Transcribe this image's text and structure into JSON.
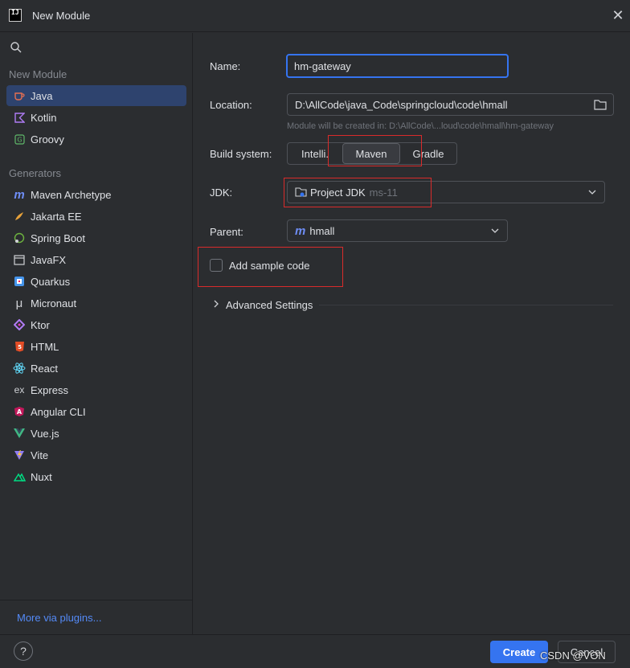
{
  "window": {
    "title": "New Module"
  },
  "sidebar": {
    "new_module_label": "New Module",
    "new_module_items": [
      {
        "label": "Java",
        "icon": "java-cup-icon",
        "color": "#e76f51"
      },
      {
        "label": "Kotlin",
        "icon": "kotlin-icon",
        "color": "#b07cf5"
      },
      {
        "label": "Groovy",
        "icon": "groovy-icon",
        "color": "#5fb86a"
      }
    ],
    "generators_label": "Generators",
    "generator_items": [
      {
        "label": "Maven Archetype",
        "icon": "maven-icon"
      },
      {
        "label": "Jakarta EE",
        "icon": "jakarta-ee-icon"
      },
      {
        "label": "Spring Boot",
        "icon": "spring-boot-icon"
      },
      {
        "label": "JavaFX",
        "icon": "javafx-icon"
      },
      {
        "label": "Quarkus",
        "icon": "quarkus-icon"
      },
      {
        "label": "Micronaut",
        "icon": "micronaut-icon"
      },
      {
        "label": "Ktor",
        "icon": "ktor-icon"
      },
      {
        "label": "HTML",
        "icon": "html5-icon"
      },
      {
        "label": "React",
        "icon": "react-icon"
      },
      {
        "label": "Express",
        "icon": "express-icon"
      },
      {
        "label": "Angular CLI",
        "icon": "angular-icon"
      },
      {
        "label": "Vue.js",
        "icon": "vue-icon"
      },
      {
        "label": "Vite",
        "icon": "vite-icon"
      },
      {
        "label": "Nuxt",
        "icon": "nuxt-icon"
      }
    ],
    "more_plugins": "More via plugins..."
  },
  "form": {
    "name_label": "Name:",
    "name_value": "hm-gateway",
    "location_label": "Location:",
    "location_value": "D:\\AllCode\\java_Code\\springcloud\\code\\hmall",
    "location_hint": "Module will be created in: D:\\AllCode\\...loud\\code\\hmall\\hm-gateway",
    "build_system_label": "Build system:",
    "build_options": [
      "Intelli.",
      "Maven",
      "Gradle"
    ],
    "build_selected": "Maven",
    "jdk_label": "JDK:",
    "jdk_value": "Project JDK",
    "jdk_version": "ms-11",
    "parent_label": "Parent:",
    "parent_value": "hmall",
    "sample_code_label": "Add sample code",
    "sample_code_checked": false,
    "advanced_label": "Advanced Settings"
  },
  "footer": {
    "help": "?",
    "create": "Create",
    "cancel": "Cancel",
    "watermark": "CSDN @VON"
  },
  "colors": {
    "accent": "#3574f0",
    "link": "#548af7",
    "highlight_box": "#d92b2b",
    "selected_bg": "#2e436e"
  }
}
